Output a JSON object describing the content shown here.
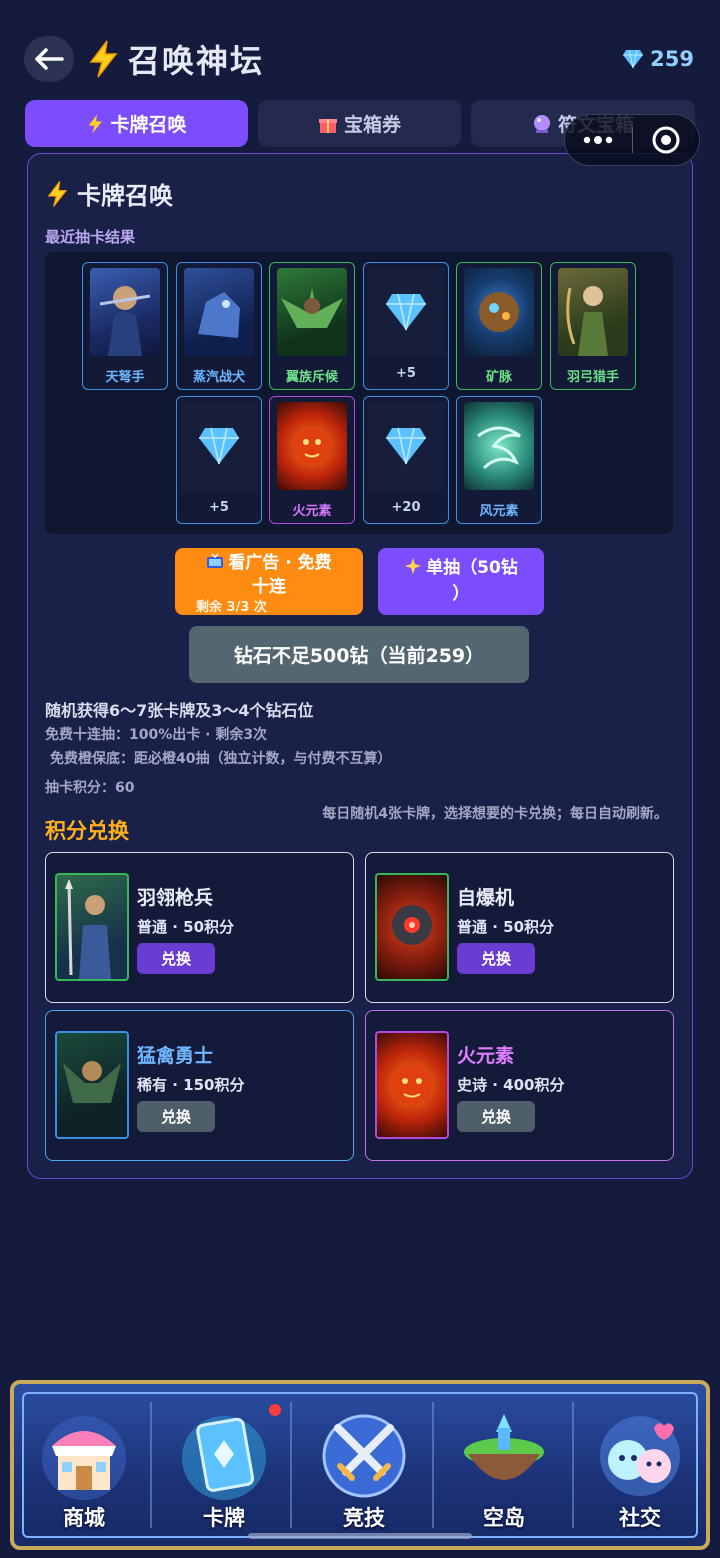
{
  "header": {
    "title": "召唤神坛",
    "diamonds": "259"
  },
  "tabs": [
    {
      "label": "卡牌召唤",
      "icon": "lightning-icon",
      "active": true
    },
    {
      "label": "宝箱券",
      "icon": "gift-icon",
      "active": false
    },
    {
      "label": "符文宝箱",
      "icon": "crystal-ball-icon",
      "active": false
    }
  ],
  "summon": {
    "section_title": "卡牌召唤",
    "recent_label": "最近抽卡结果",
    "results": [
      {
        "name": "天弩手",
        "kind": "card",
        "rarity": "rare"
      },
      {
        "name": "蒸汽战犬",
        "kind": "card",
        "rarity": "rare"
      },
      {
        "name": "翼族斥候",
        "kind": "card",
        "rarity": "common"
      },
      {
        "name": "+5",
        "kind": "diamond"
      },
      {
        "name": "矿脉",
        "kind": "card",
        "rarity": "common"
      },
      {
        "name": "羽弓猎手",
        "kind": "card",
        "rarity": "common"
      },
      {
        "name": "+5",
        "kind": "diamond"
      },
      {
        "name": "火元素",
        "kind": "card",
        "rarity": "epic"
      },
      {
        "name": "+20",
        "kind": "diamond"
      },
      {
        "name": "风元素",
        "kind": "card",
        "rarity": "rare"
      }
    ],
    "ad_button": {
      "line1": "看广告 · 免费",
      "line2": "十连",
      "remaining": "剩余 3/3 次"
    },
    "single_button": {
      "line1": "单抽（50钻",
      "line2": "）"
    },
    "disabled_button": "钻石不足500钻（当前259）",
    "info_main": "随机获得6～7张卡牌及3～4个钻石位",
    "info_free": "免费十连抽：100%出卡 · 剩余3次",
    "info_pity": "免费橙保底：距必橙40抽（独立计数，与付费不互算）",
    "points": "抽卡积分：60"
  },
  "exchange": {
    "title": "积分兑换",
    "note": "每日随机4张卡牌，选择想要的卡兑换；每日自动刷新。",
    "items": [
      {
        "name": "羽翎枪兵",
        "meta": "普通 · 50积分",
        "button": "兑换",
        "rarity": "common",
        "enabled": true
      },
      {
        "name": "自爆机",
        "meta": "普通 · 50积分",
        "button": "兑换",
        "rarity": "common",
        "enabled": true
      },
      {
        "name": "猛禽勇士",
        "meta": "稀有 · 150积分",
        "button": "兑换",
        "rarity": "rare",
        "enabled": false
      },
      {
        "name": "火元素",
        "meta": "史诗 · 400积分",
        "button": "兑换",
        "rarity": "epic",
        "enabled": false
      }
    ]
  },
  "nav": [
    {
      "label": "商城",
      "icon": "shop-icon"
    },
    {
      "label": "卡牌",
      "icon": "card-book-icon",
      "badge": true
    },
    {
      "label": "竞技",
      "icon": "crossed-swords-icon"
    },
    {
      "label": "空岛",
      "icon": "sky-island-icon"
    },
    {
      "label": "社交",
      "icon": "social-icon"
    }
  ],
  "colors": {
    "accent": "#7c4dff",
    "orange": "#ff8c12",
    "rare": "#4ca6f0",
    "common": "#36b85a",
    "epic": "#b24bd8",
    "background": "#151b3d"
  }
}
